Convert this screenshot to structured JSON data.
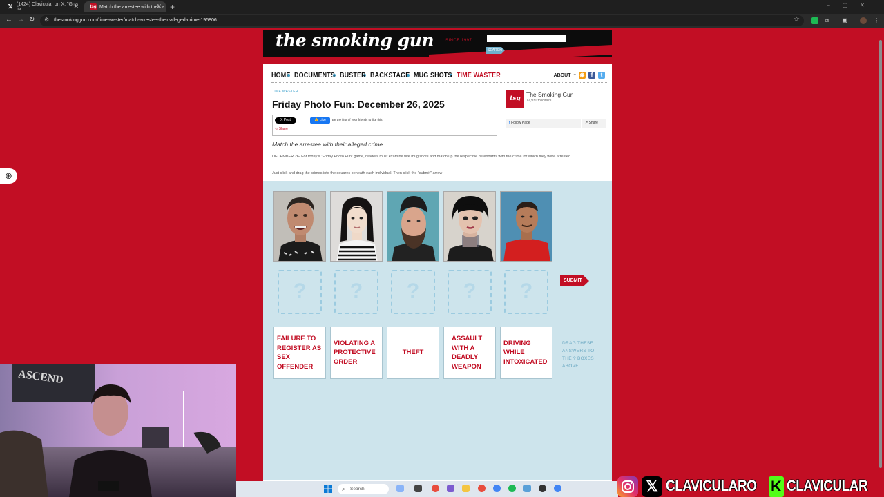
{
  "browser": {
    "tabs": [
      {
        "label": "(1424) Clavicular on X: \"Gna liv",
        "active": false
      },
      {
        "label": "Match the arrestee with their a",
        "active": true
      }
    ],
    "url": "thesmokinggun.com/time-waster/match-arrestee-their-alleged-crime-195806"
  },
  "site": {
    "logo": "the smoking gun",
    "since": "SINCE 1997",
    "search_label": "SEARCH",
    "nav": [
      "HOME",
      "DOCUMENTS",
      "BUSTER",
      "BACKSTAGE",
      "MUG SHOTS",
      "TIME WASTER"
    ],
    "nav_active": "TIME WASTER",
    "about": "ABOUT",
    "brand_red": "#c20e24",
    "accent_blue": "#3ca0cc"
  },
  "article": {
    "section": "TIME WASTER",
    "title": "Friday Photo Fun: December 26, 2025",
    "subtitle": "Match the arrestee with their alleged crime",
    "intro": "DECEMBER 26- For today's \"Friday Photo Fun\" game, readers must examine five mug shots and match up the respective defendants with the crime for which they were arrested.",
    "instructions": "Just click and drag the crimes into the squares beneath each individual. Then click the \"submit\" arrow"
  },
  "share": {
    "x_post": "X Post",
    "fb_like": "Like",
    "fb_like_text": "Be the first of your friends to like this",
    "share": "Share"
  },
  "fb_widget": {
    "badge": "tsg",
    "page_name": "The Smoking Gun",
    "followers": "72,931 followers",
    "follow": "Follow Page",
    "share": "Share"
  },
  "game": {
    "slot_placeholder": "?",
    "submit": "SUBMIT",
    "answers": [
      "FAILURE TO REGISTER AS SEX OFFENDER",
      "VIOLATING A PROTECTIVE ORDER",
      "THEFT",
      "ASSAULT WITH A DEADLY WEAPON",
      "DRIVING WHILE INTOXICATED"
    ],
    "drag_hint": "DRAG THESE ANSWERS TO THE ? BOXES ABOVE"
  },
  "taskbar": {
    "search": "Search"
  },
  "banner": {
    "handle_1": "CLAVICULARO",
    "handle_2": "CLAVICULAR"
  }
}
